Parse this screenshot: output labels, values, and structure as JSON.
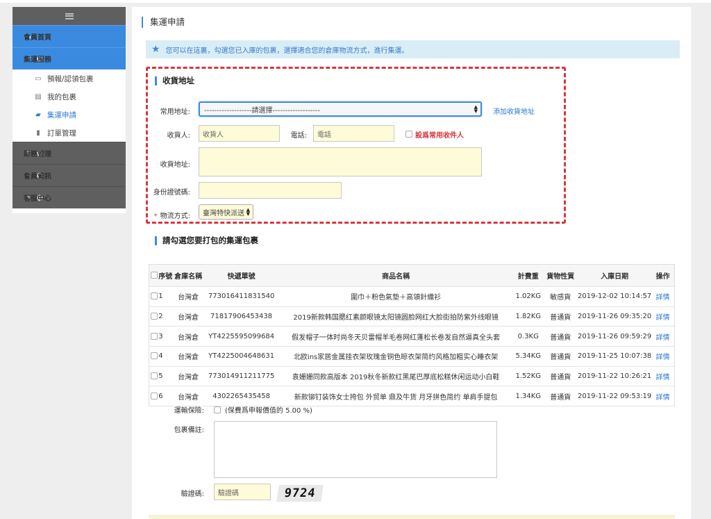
{
  "sidebar": {
    "items": [
      {
        "label": "會員首頁",
        "icon": "home-icon"
      },
      {
        "label": "集運服務",
        "icon": "caret-down-icon"
      },
      {
        "label": "財務管理",
        "icon": "caret-down-icon"
      },
      {
        "label": "會員資訊",
        "icon": "caret-down-icon"
      },
      {
        "label": "客服中心",
        "icon": "caret-down-icon"
      }
    ],
    "sub_items": [
      {
        "label": "預報/認領包裹",
        "icon": "inbox-icon"
      },
      {
        "label": "我的包裹",
        "icon": "list-icon"
      },
      {
        "label": "集運申請",
        "icon": "truck-icon"
      },
      {
        "label": "訂單管理",
        "icon": "book-icon"
      }
    ]
  },
  "page": {
    "title": "集運申請",
    "notice": "您可以在這裏，勾選您已入庫的包裹，選擇適合您的倉庫物流方式，進行集運。"
  },
  "address": {
    "section_title": "收貨地址",
    "common_label": "常用地址:",
    "common_value": "-------------------請選擇-------------------",
    "add_link": "添加收貨地址",
    "receiver_label": "收貨人:",
    "receiver_placeholder": "收貨人",
    "phone_label": "電話:",
    "phone_placeholder": "電話",
    "set_common_label": "設爲常用收件人",
    "address_label": "收貨地址:",
    "id_label": "身份證號碼:",
    "shipping_label": "物流方式:",
    "shipping_required": "*",
    "shipping_value": "臺灣特快派送"
  },
  "packages": {
    "section_title": "請勾選您要打包的集運包裹",
    "headers": [
      "序號",
      "倉庫名稱",
      "快遞單號",
      "商品名稱",
      "計費重",
      "貨物性質",
      "入庫日期",
      "操作"
    ],
    "rows": [
      {
        "no": "1",
        "warehouse": "台灣倉",
        "tracking": "773016411831540",
        "name": "圍巾＋粉色氣墊＋高領針織衫",
        "weight": "1.02KG",
        "type": "敏感貨",
        "date": "2019-12-02 10:14:57",
        "action": "詳情"
      },
      {
        "no": "2",
        "warehouse": "台灣倉",
        "tracking": "71817906453438",
        "name": "2019新款韩国腮红素颜眼镜太阳镜圆脸网红大脸街拍防紫外线眼镜",
        "weight": "1.82KG",
        "type": "普通貨",
        "date": "2019-11-26 09:35:20",
        "action": "詳情"
      },
      {
        "no": "3",
        "warehouse": "台灣倉",
        "tracking": "YT4225595099684",
        "name": "假发帽子一体时尚冬天贝雷帽羊毛卷网红蓬松长卷发自然逼真全头套",
        "weight": "0.3KG",
        "type": "普通貨",
        "date": "2019-11-26 09:59:29",
        "action": "詳情"
      },
      {
        "no": "4",
        "warehouse": "台灣倉",
        "tracking": "YT4225004648631",
        "name": "北欧ins家居金属挂衣架玫瑰金铜色晾衣架简约风格加粗实心睡衣架",
        "weight": "5.34KG",
        "type": "普通貨",
        "date": "2019-11-25 10:07:38",
        "action": "詳情"
      },
      {
        "no": "5",
        "warehouse": "台灣倉",
        "tracking": "773014911211775",
        "name": "袁姗姗同款高版本 2019秋冬新款红黑尾巴厚底松糕休闲运动小白鞋",
        "weight": "1.52KG",
        "type": "普通貨",
        "date": "2019-11-22 10:26:21",
        "action": "詳情"
      },
      {
        "no": "6",
        "warehouse": "台灣倉",
        "tracking": "4302265435458",
        "name": "新款铆钉装饰女士挎包 外贸单 鼎及牛货 月牙拼色简约 单肩手提包",
        "weight": "1.34KG",
        "type": "普通貨",
        "date": "2019-11-22 09:53:19",
        "action": "詳情"
      }
    ]
  },
  "extra": {
    "insurance_label": "運輸保險:",
    "insurance_text": "(保費爲申報價值的 5.00 %)",
    "remark_label": "包裹備註:",
    "captcha_label": "驗證碼:",
    "captcha_placeholder": "驗證碼",
    "captcha_value": "9724"
  },
  "colors": {
    "accent": "#3a8be0",
    "sidebar_dark": "#5f5f5f",
    "highlight_border": "#d9353e",
    "input_bg": "#fefbd8"
  }
}
